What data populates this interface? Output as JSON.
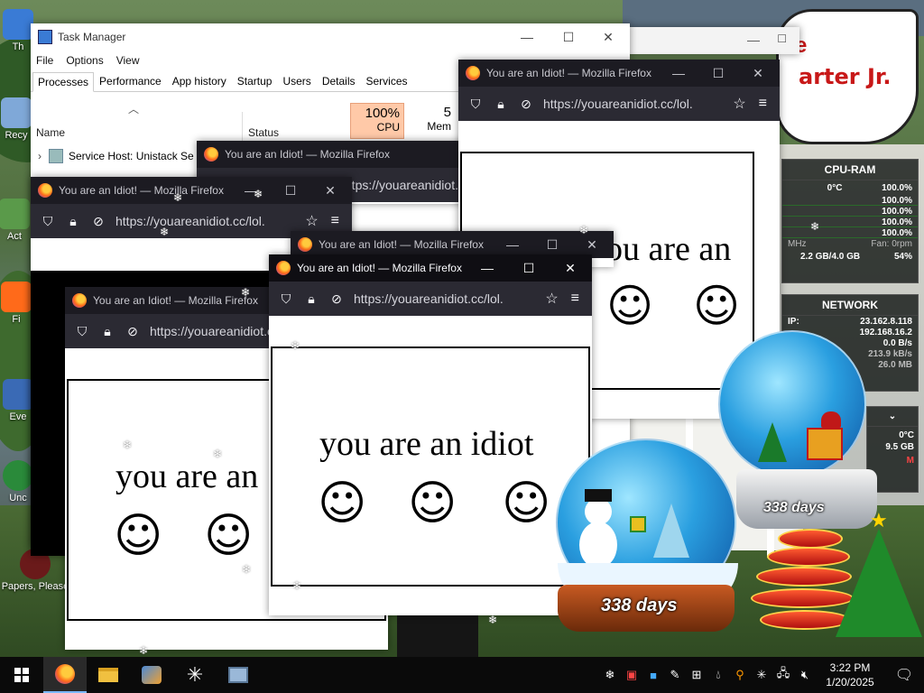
{
  "desktop": {
    "icons": [
      {
        "name": "desk-icon-top",
        "label": "Th",
        "color": "#3a7bd5"
      },
      {
        "name": "desk-icon-recycle",
        "label": "Recy",
        "color": "#7fa8d8"
      },
      {
        "name": "desk-icon-act",
        "label": "Act",
        "color": "#5a9a4a"
      },
      {
        "name": "desk-icon-fi",
        "label": "Fi",
        "color": "#ff6a1a"
      },
      {
        "name": "desk-icon-eve",
        "label": "Eve",
        "color": "#3a6ab5"
      },
      {
        "name": "desk-icon-unc",
        "label": "Unc",
        "color": "#2a8a3a"
      },
      {
        "name": "desk-icon-papers",
        "label": "Papers, Please",
        "color": "#6a1a1a"
      }
    ],
    "speech_bubble": {
      "line1": "e",
      "line2": "arter Jr."
    }
  },
  "task_manager": {
    "title": "Task Manager",
    "menu": [
      "File",
      "Options",
      "View"
    ],
    "tabs": [
      "Processes",
      "Performance",
      "App history",
      "Startup",
      "Users",
      "Details",
      "Services"
    ],
    "selected_tab": "Processes",
    "col_name": "Name",
    "col_status": "Status",
    "cpu_percent": "100%",
    "cpu_label": "CPU",
    "mem_percent": "5",
    "mem_label": "Mem",
    "row": "Service Host: Unistack Se"
  },
  "firefox": {
    "title": "You are an Idiot! — Mozilla Firefox",
    "url": "https://youareanidiot.cc/lol.",
    "page_text": "you are an idiot",
    "page_text_cut": "you are an",
    "smiley": "☺"
  },
  "cpu_ram_gadget": {
    "title": "CPU-RAM",
    "temp": "0°C",
    "cpu_total": "100.0%",
    "cores": [
      "100.0%",
      "100.0%",
      "100.0%",
      "100.0%"
    ],
    "mhz_label": "MHz",
    "fan": "Fan: 0rpm",
    "ram": "2.2 GB/4.0 GB",
    "ram_pct": "54%"
  },
  "network_gadget": {
    "title": "NETWORK",
    "ip_label": "IP:",
    "ext_ip": "23.162.8.118",
    "int_ip": "192.168.16.2",
    "up": "0.0 B/s",
    "down": "213.9 kB/s",
    "total": "26.0 MB"
  },
  "drive_gadget": {
    "temp": "0°C",
    "size": "9.5 GB",
    "label": "M"
  },
  "globes": {
    "front_days": "338 days",
    "back_days": "338 days"
  },
  "taskbar": {
    "time": "3:22 PM",
    "date": "1/20/2025"
  }
}
